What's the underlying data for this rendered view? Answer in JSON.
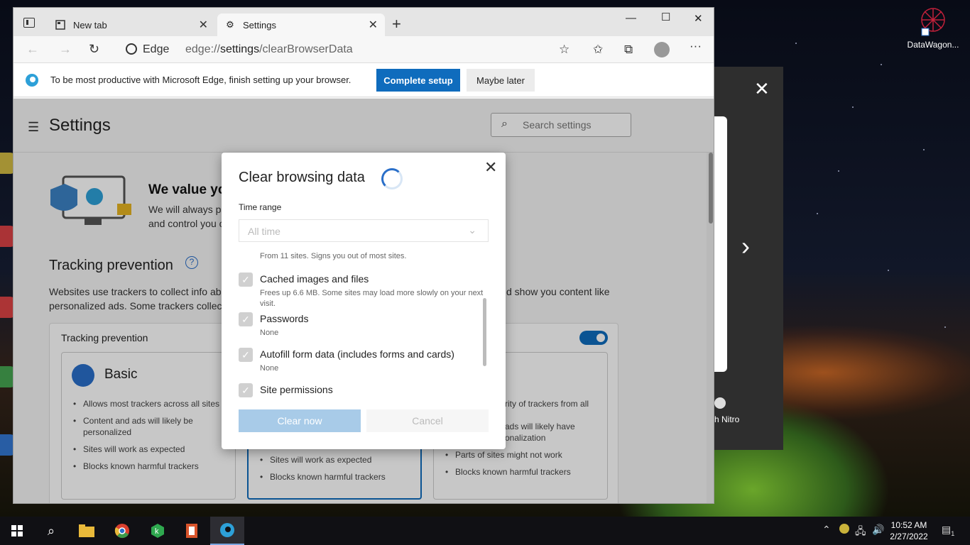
{
  "desktop": {
    "icon_label": "DataWagon..."
  },
  "overlay": {
    "partial_text": "h Nitro"
  },
  "browser": {
    "tabs": [
      {
        "label": "New tab"
      },
      {
        "label": "Settings"
      }
    ],
    "address": {
      "site": "Edge",
      "url_prefix": "edge://",
      "url_main": "settings",
      "url_rest": "/clearBrowserData"
    },
    "infobar": {
      "message": "To be most productive with Microsoft Edge, finish setting up your browser.",
      "primary": "Complete setup",
      "secondary": "Maybe later"
    }
  },
  "settings": {
    "title": "Settings",
    "search_placeholder": "Search settings",
    "privacy_heading": "We value yo",
    "privacy_text": "We will always pr and control you c",
    "tracking_title": "Tracking prevention",
    "tracking_desc": "Websites use trackers to collect info abo personalized ads. Some trackers collect",
    "tracking_desc_right": "d show you content like",
    "card_title": "Tracking prevention",
    "options": [
      {
        "name": "Basic",
        "bullets": [
          "Allows most trackers across all sites",
          "Content and ads will likely be personalized",
          "Sites will work as expected",
          "Blocks known harmful trackers"
        ]
      },
      {
        "name": "",
        "bullets": [
          "Sites will work as expected",
          "Blocks known harmful trackers"
        ]
      },
      {
        "name": "t",
        "bullets": [
          "rity of trackers from all",
          "ads will likely have onalization",
          "Parts of sites might not work",
          "Blocks known harmful trackers"
        ]
      }
    ]
  },
  "dialog": {
    "title": "Clear browsing data",
    "time_range_label": "Time range",
    "time_range_value": "All time",
    "cut_text": "From 11 sites. Signs you out of most sites.",
    "items": [
      {
        "label": "Cached images and files",
        "sub": "Frees up 6.6 MB. Some sites may load more slowly on your next visit."
      },
      {
        "label": "Passwords",
        "sub": "None"
      },
      {
        "label": "Autofill form data (includes forms and cards)",
        "sub": "None"
      },
      {
        "label": "Site permissions",
        "sub": ""
      }
    ],
    "clear_label": "Clear now",
    "cancel_label": "Cancel"
  },
  "taskbar": {
    "time": "10:52 AM",
    "date": "2/27/2022",
    "notif_count": "1"
  }
}
